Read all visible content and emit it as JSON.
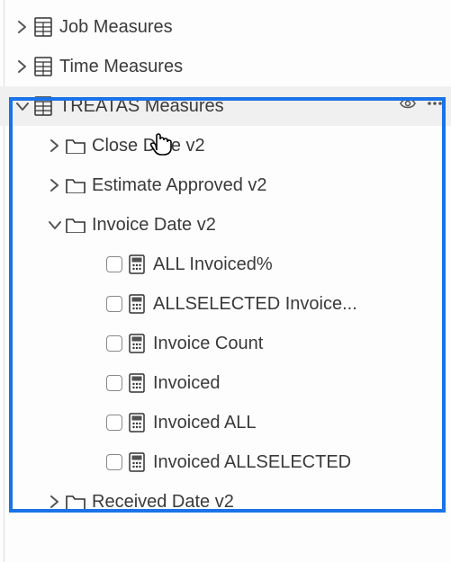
{
  "tree": {
    "top": [
      {
        "label": "Job Measures"
      },
      {
        "label": "Time Measures"
      }
    ],
    "group": {
      "label": "TREATAS Measures",
      "folders": {
        "closeDate": "Close   Date v2",
        "estimateApproved": "Estimate Approved v2",
        "invoiceDate": "Invoice Date v2",
        "receivedDate": "Received Date v2"
      },
      "invoiceMeasures": [
        "ALL Invoiced%",
        "ALLSELECTED Invoice...",
        "Invoice Count",
        "Invoiced",
        "Invoiced ALL",
        "Invoiced ALLSELECTED"
      ]
    }
  }
}
